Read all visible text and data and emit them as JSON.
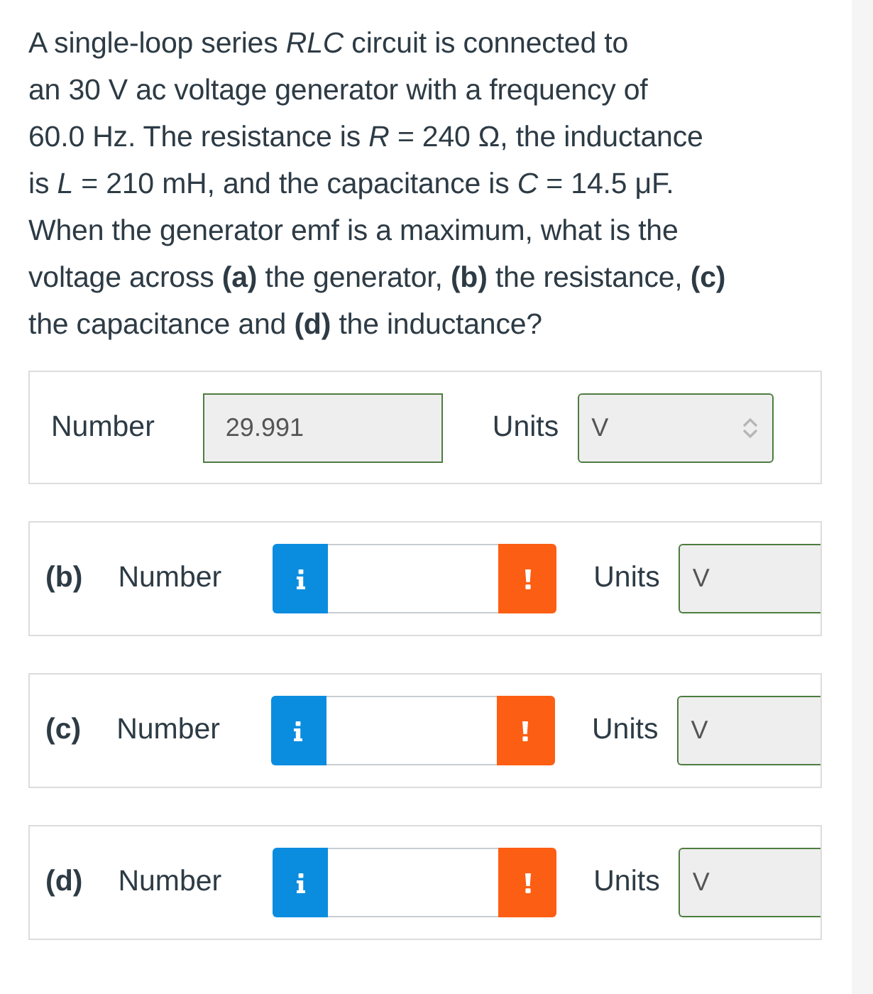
{
  "question": {
    "text": "A single-loop series *RLC* circuit is connected to\nan 30 V ac voltage generator with a frequency of\n60.0 Hz. The resistance is *R* = 240 Ω, the inductance\nis *L* = 210 mH, and the capacitance is *C* = 14.5 μF.\nWhen the generator emf is a maximum, what is the\nvoltage across **(a)** the generator, **(b)** the resistance, **(c)**\nthe capacitance and **(d)** the inductance?"
  },
  "parts": [
    {
      "kind": "answered",
      "number_label": "Number",
      "value": "29.991",
      "units_label": "Units",
      "unit": "V"
    },
    {
      "kind": "blank",
      "part_label": "(b)",
      "number_label": "Number",
      "units_label": "Units",
      "unit": "V"
    },
    {
      "kind": "blank",
      "part_label": "(c)",
      "number_label": "Number",
      "units_label": "Units",
      "unit": "V"
    },
    {
      "kind": "blank",
      "part_label": "(d)",
      "number_label": "Number",
      "units_label": "Units",
      "unit": "V"
    }
  ]
}
